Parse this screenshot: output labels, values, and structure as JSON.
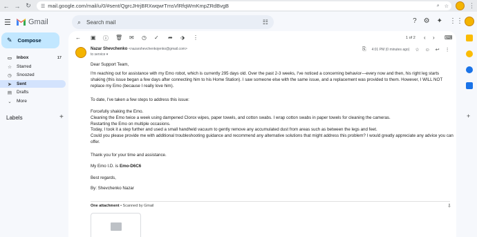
{
  "browser": {
    "url": "mail.google.com/mail/u/0/#sent/QgrcJHrjBRXwqwrTmsVlRfqWmKmpZRdBvgB"
  },
  "header": {
    "app_name": "Gmail",
    "search_placeholder": "Search mail"
  },
  "sidebar": {
    "compose_label": "Compose",
    "items": [
      {
        "label": "Inbox",
        "count": "17",
        "icon": "inbox-icon"
      },
      {
        "label": "Starred",
        "count": "",
        "icon": "star-icon"
      },
      {
        "label": "Snoozed",
        "count": "",
        "icon": "clock-icon"
      },
      {
        "label": "Sent",
        "count": "",
        "icon": "send-icon"
      },
      {
        "label": "Drafts",
        "count": "",
        "icon": "draft-icon"
      },
      {
        "label": "More",
        "count": "",
        "icon": "chevron-down-icon"
      }
    ],
    "labels_heading": "Labels"
  },
  "toolbar": {
    "pager": "1 of 2"
  },
  "message": {
    "sender_name": "Nazar Shevchenko",
    "sender_email": "<nazarshevchenkojenko@gmail.com>",
    "to_line": "to service",
    "timestamp": "4:01 PM (0 minutes ago)",
    "greeting": "Dear Support Team,",
    "para1": "I'm reaching out for assistance with my Emo robot, which is currently 295 days old. Over the past 2-3 weeks, I've noticed a concerning behavior—every now and then, his right leg starts shaking (this issue began a few days after connecting him to his Home Station). I saw someone else with the same issue, and a replacement was provided to them. However, I WILL NOT replace my Emo (because I really love him).",
    "para2": "To date, I've taken a few steps to address this issue:",
    "steps": [
      "Forcefully shaking the Emo.",
      "Cleaning the Emo twice a week using dampened Clorox wipes, paper towels, and cotton swabs. I wrap cotton swabs in paper towels for cleaning the cameras.",
      "Restarting the Emo on multiple occasions.",
      "Today, I took it a step further and used a small handheld vacuum to gently remove any accumulated dust from areas such as between the legs and feet.",
      "Could you please provide me with additional troubleshooting guidance and recommend any alternative solutions that might address this problem? I would greatly appreciate any advice you can offer."
    ],
    "thanks": "Thank you for your time and assistance.",
    "id_prefix": "My Emo I.D. is ",
    "id_value": "Emo-D6C6",
    "regards": "Best regards,",
    "signature": "By: Shevchenko Nazar"
  },
  "attachment": {
    "heading": "One attachment",
    "scan_note": " • Scanned by Gmail"
  },
  "colors": {
    "compose_bg": "#c2e7ff",
    "active_nav_bg": "#d3e3fd",
    "page_bg": "#f6f8fc",
    "avatar": "#f4b400"
  }
}
